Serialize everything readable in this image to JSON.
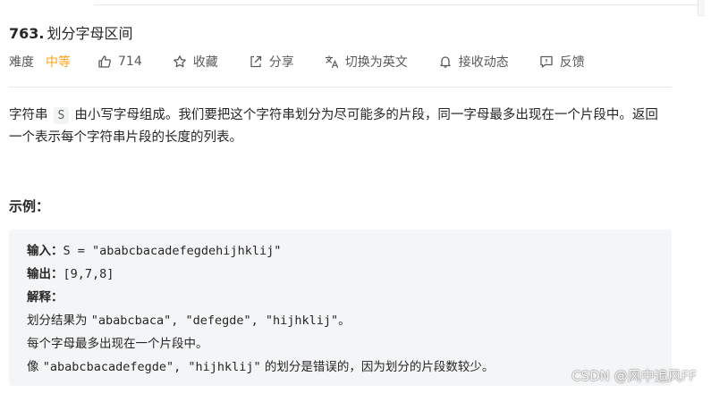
{
  "problem": {
    "number": "763.",
    "name": "划分字母区间"
  },
  "meta": {
    "difficulty_label": "难度",
    "difficulty_value": "中等",
    "likes": "714",
    "collect": "收藏",
    "share": "分享",
    "translate": "切换为英文",
    "follow": "接收动态",
    "feedback": "反馈",
    "difficulty_color": "#ffa116"
  },
  "description": {
    "part1": "字符串",
    "inline_code": "S",
    "part2": "由小写字母组成。我们要把这个字符串划分为尽可能多的片段，同一字母最多出现在一个片段中。返回一个表示每个字符串片段的长度的列表。"
  },
  "example": {
    "title": "示例：",
    "input_label": "输入：",
    "input_value": "S = \"ababcbacadefegdehijhklij\"",
    "output_label": "输出：",
    "output_value": "[9,7,8]",
    "explain_label": "解释：",
    "explain_line1_a": "划分结果为 ",
    "explain_line1_b": "\"ababcbaca\", \"defegde\", \"hijhklij\"",
    "explain_line1_c": "。",
    "explain_line2": "每个字母最多出现在一个片段中。",
    "explain_line3_a": "像 ",
    "explain_line3_b": "\"ababcbacadefegde\", \"hijhklij\"",
    "explain_line3_c": " 的划分是错误的，因为划分的片段数较少。"
  },
  "watermark": "CSDN @风中追风FF",
  "icons": {
    "like": "thumbs-up-icon",
    "collect": "star-icon",
    "share": "share-icon",
    "translate": "translate-icon",
    "follow": "bell-icon",
    "feedback": "feedback-icon"
  }
}
